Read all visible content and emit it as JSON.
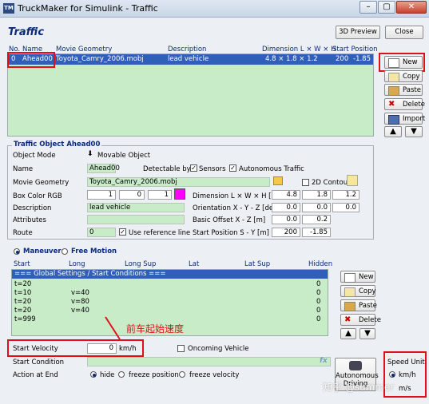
{
  "window": {
    "title": "TruckMaker for Simulink - Traffic",
    "app_icon": "TM"
  },
  "header": {
    "panel_title": "Traffic",
    "preview_btn": "3D Preview",
    "close_btn": "Close"
  },
  "table": {
    "columns": {
      "no": "No.",
      "name": "Name",
      "movie": "Movie Geometry",
      "desc": "Description",
      "dim": "Dimension L × W × H",
      "start": "Start Position"
    },
    "row": {
      "no": "0",
      "name": "Ahead00",
      "movie": "Toyota_Camry_2006.mobj",
      "desc": "lead vehicle",
      "dim": "4.8 × 1.8 × 1.2",
      "start_s": "200",
      "start_y": "-1.85"
    }
  },
  "side_buttons": [
    "New",
    "Copy",
    "Paste",
    "Delete",
    "Import"
  ],
  "object": {
    "group_title": "Traffic Object Ahead00",
    "object_mode_label": "Object Mode",
    "object_mode_value": "Movable Object",
    "name_label": "Name",
    "name_value": "Ahead00",
    "detectable_label": "Detectable by",
    "sensors_label": "Sensors",
    "autonomous_label": "Autonomous Traffic",
    "movie_label": "Movie Geometry",
    "movie_value": "Toyota_Camry_2006.mobj",
    "contour_label": "2D Contour",
    "color_label": "Box Color RGB",
    "rgb": [
      "1",
      "0",
      "1"
    ],
    "dim_label": "Dimension L × W × H [m]",
    "dim": [
      "4.8",
      "1.8",
      "1.2"
    ],
    "desc_label": "Description",
    "desc_value": "lead vehicle",
    "orient_label": "Orientation X - Y - Z [deg]",
    "orient": [
      "0.0",
      "0.0",
      "0.0"
    ],
    "attr_label": "Attributes",
    "offset_label": "Basic Offset X - Z [m]",
    "offset": [
      "0.0",
      "0.2"
    ],
    "route_label": "Route",
    "route_value": "0",
    "use_ref_label": "Use reference line",
    "startpos_label": "Start Position S - Y [m]",
    "startpos": [
      "200",
      "-1.85"
    ]
  },
  "maneuver": {
    "tab1": "Maneuver",
    "tab2": "Free Motion",
    "columns": {
      "start": "Start",
      "long": "Long",
      "longsup": "Long Sup",
      "lat": "Lat",
      "latsup": "Lat Sup",
      "hidden": "Hidden"
    },
    "rows": [
      {
        "start": "=== Global Settings / Start Conditions ===",
        "long": "",
        "hidden": ""
      },
      {
        "start": "t=20",
        "long": "",
        "hidden": "0"
      },
      {
        "start": "t=10",
        "long": "v=40",
        "hidden": "0"
      },
      {
        "start": "t=20",
        "long": "v=80",
        "hidden": "0"
      },
      {
        "start": "t=20",
        "long": "v=40",
        "hidden": "0"
      },
      {
        "start": "t=999",
        "long": "",
        "hidden": "0"
      }
    ],
    "buttons": [
      "New",
      "Copy",
      "Paste",
      "Delete"
    ]
  },
  "bottom": {
    "annotation": "前车起始速度",
    "start_velocity_label": "Start Velocity",
    "start_velocity_value": "0",
    "start_velocity_unit": "km/h",
    "oncoming_label": "Oncoming Vehicle",
    "start_condition_label": "Start Condition",
    "action_label": "Action at End",
    "actions": [
      "hide",
      "freeze position",
      "freeze velocity"
    ],
    "autonomous_btn": "Autonomous Driving",
    "speed_unit_title": "Speed Unit",
    "speed_units": [
      "km/h",
      "m/s"
    ]
  },
  "watermark": "知乎 @summer"
}
